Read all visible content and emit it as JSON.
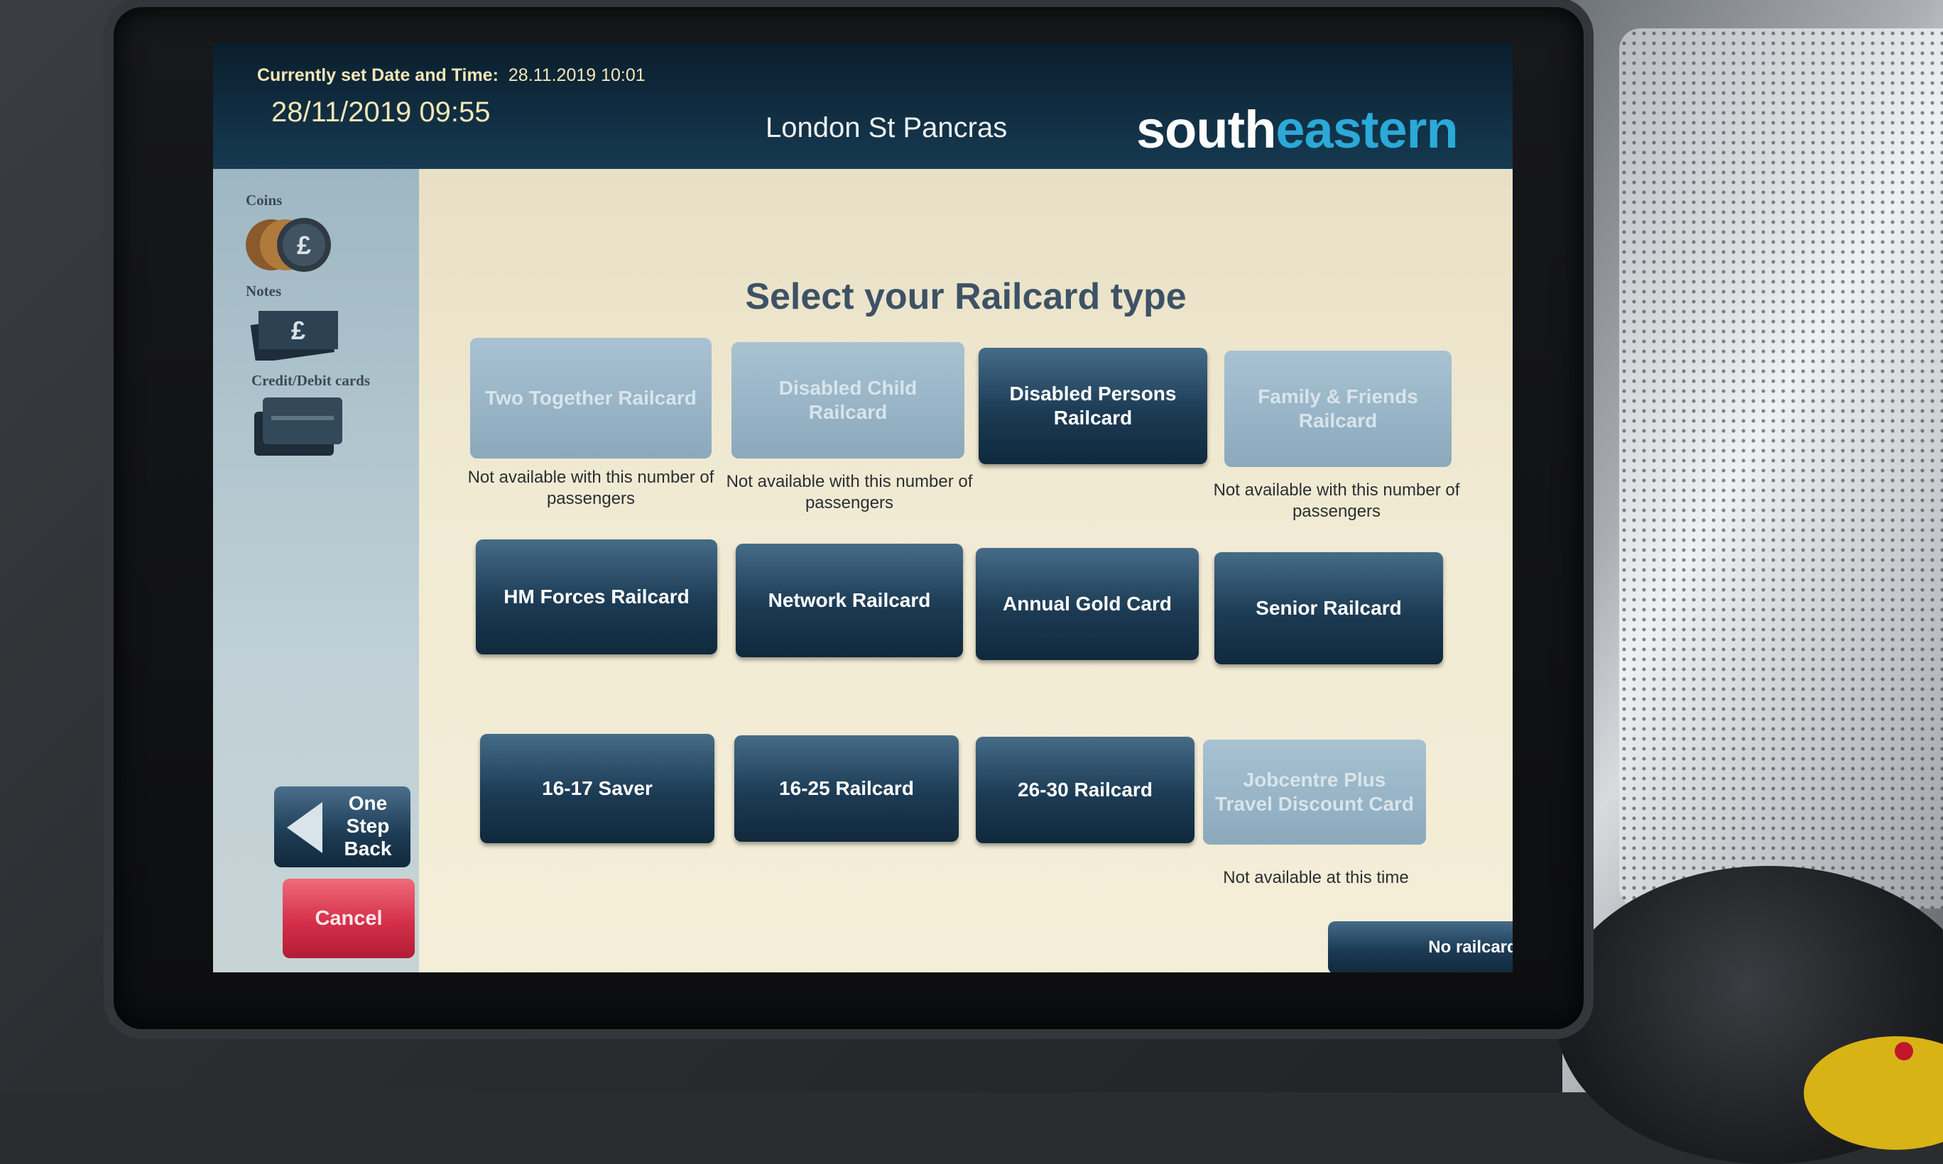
{
  "header": {
    "set_label": "Currently set Date and Time:",
    "set_value": "28.11.2019  10:01",
    "datetime": "28/11/2019  09:55",
    "station": "London St Pancras",
    "logo_part1": "south",
    "logo_part2": "eastern",
    "logo_colors": {
      "south": "#ffffff",
      "eastern": "#2ba9d8"
    }
  },
  "payment": {
    "coins_label": "Coins",
    "notes_label": "Notes",
    "cards_label": "Credit/Debit cards",
    "icons": [
      "coins-icon",
      "banknote-icon",
      "credit-card-icon"
    ]
  },
  "title": "Select your Railcard type",
  "railcards": [
    {
      "label": "Two Together Railcard",
      "enabled": false
    },
    {
      "label": "Disabled Child Railcard",
      "enabled": false
    },
    {
      "label": "Disabled Persons Railcard",
      "enabled": true
    },
    {
      "label": "Family & Friends Railcard",
      "enabled": false
    },
    {
      "label": "HM Forces Railcard",
      "enabled": true
    },
    {
      "label": "Network Railcard",
      "enabled": true
    },
    {
      "label": "Annual Gold Card",
      "enabled": true
    },
    {
      "label": "Senior Railcard",
      "enabled": true
    },
    {
      "label": "16-17 Saver",
      "enabled": true
    },
    {
      "label": "16-25 Railcard",
      "enabled": true
    },
    {
      "label": "26-30 Railcard",
      "enabled": true
    },
    {
      "label": "Jobcentre Plus Travel Discount Card",
      "enabled": false
    }
  ],
  "notes": {
    "passengers": "Not available with this number of passengers",
    "time": "Not available at this time"
  },
  "nav": {
    "back_line1": "One",
    "back_line2": "Step",
    "back_line3": "Back",
    "cancel": "Cancel",
    "no_railcard": "No railcard"
  },
  "colors": {
    "button_active": "#1c3b54",
    "button_disabled": "#8ba9bc",
    "cancel": "#d4304a",
    "background": "#f1ead3"
  }
}
